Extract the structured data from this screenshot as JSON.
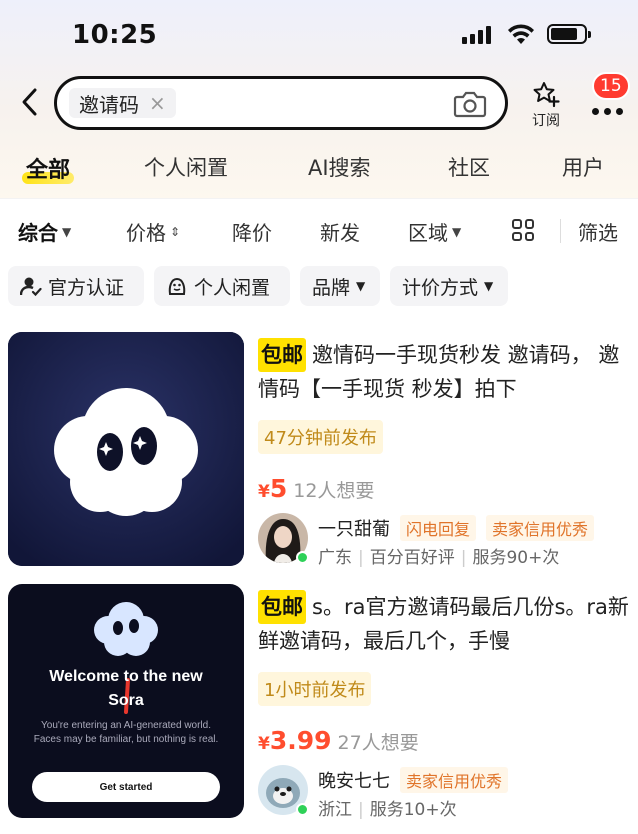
{
  "status_bar": {
    "time": "10:25"
  },
  "search": {
    "query": "邀请码",
    "clear_symbol": "×",
    "subscribe_label": "订阅",
    "notification_count": "15"
  },
  "tabs": [
    {
      "label": "全部",
      "active": true
    },
    {
      "label": "个人闲置"
    },
    {
      "label": "AI搜索"
    },
    {
      "label": "社区"
    },
    {
      "label": "用户"
    }
  ],
  "sort": {
    "comprehensive": "综合",
    "price": "价格",
    "price_drop": "降价",
    "new": "新发",
    "region": "区域",
    "filter": "筛选"
  },
  "filters": [
    "官方认证",
    "个人闲置",
    "品牌",
    "计价方式"
  ],
  "products": [
    {
      "free_shipping": "包邮",
      "title": "邀情码一手现货秒发 邀请码， 邀情码【一手现货 秒发】拍下",
      "time": "47分钟前发布",
      "currency": "¥",
      "price": "5",
      "wants": "12人想要",
      "seller_name": "一只甜葡",
      "seller_tags": [
        "闪电回复",
        "卖家信用优秀"
      ],
      "seller_location": "广东",
      "seller_meta": [
        "百分百好评",
        "服务90+次"
      ]
    },
    {
      "free_shipping": "包邮",
      "title": "s。ra官方邀请码最后几份s。ra新鲜邀请码，最后几个，手慢",
      "time": "1小时前发布",
      "currency": "¥",
      "price": "3.99",
      "wants": "27人想要",
      "seller_name": "晚安七七",
      "seller_tags": [
        "卖家信用优秀"
      ],
      "seller_location": "浙江",
      "seller_meta": [
        "服务10+次"
      ],
      "thumb_text": {
        "welcome": "Welcome to the new",
        "brand": "Sora",
        "line1": "You're entering an AI-generated world.",
        "line2": "Faces may be familiar, but nothing is real.",
        "button": "Get started"
      }
    }
  ],
  "colors": {
    "accent_yellow": "#ffe100",
    "price_red": "#ff4d2e",
    "badge_red": "#ff3b30",
    "online_green": "#2ed158"
  }
}
